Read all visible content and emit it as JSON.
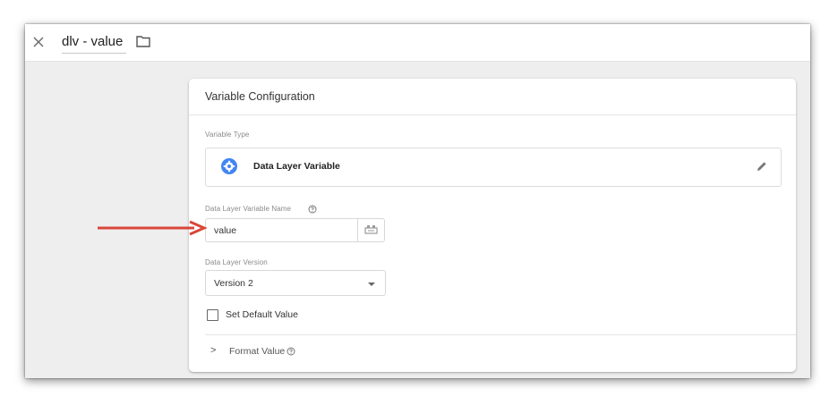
{
  "topbar": {
    "close_icon": "close-icon",
    "title": "dlv - value",
    "folder_icon": "folder-icon"
  },
  "card": {
    "title": "Variable Configuration",
    "variable_type": {
      "label": "Variable Type",
      "value": "Data Layer Variable",
      "icon": "gear-icon",
      "edit_icon": "pencil-icon"
    },
    "name_field": {
      "label": "Data Layer Variable Name",
      "value": "value",
      "picker_icon": "variable-picker-icon"
    },
    "version": {
      "label": "Data Layer Version",
      "selected": "Version 2"
    },
    "default_value": {
      "label": "Set Default Value",
      "checked": false
    },
    "format_value": {
      "label": "Format Value"
    }
  },
  "annotation": {
    "arrow_color": "#d9473a"
  },
  "colors": {
    "accent": "#4285f4",
    "background": "#eeeeee"
  }
}
